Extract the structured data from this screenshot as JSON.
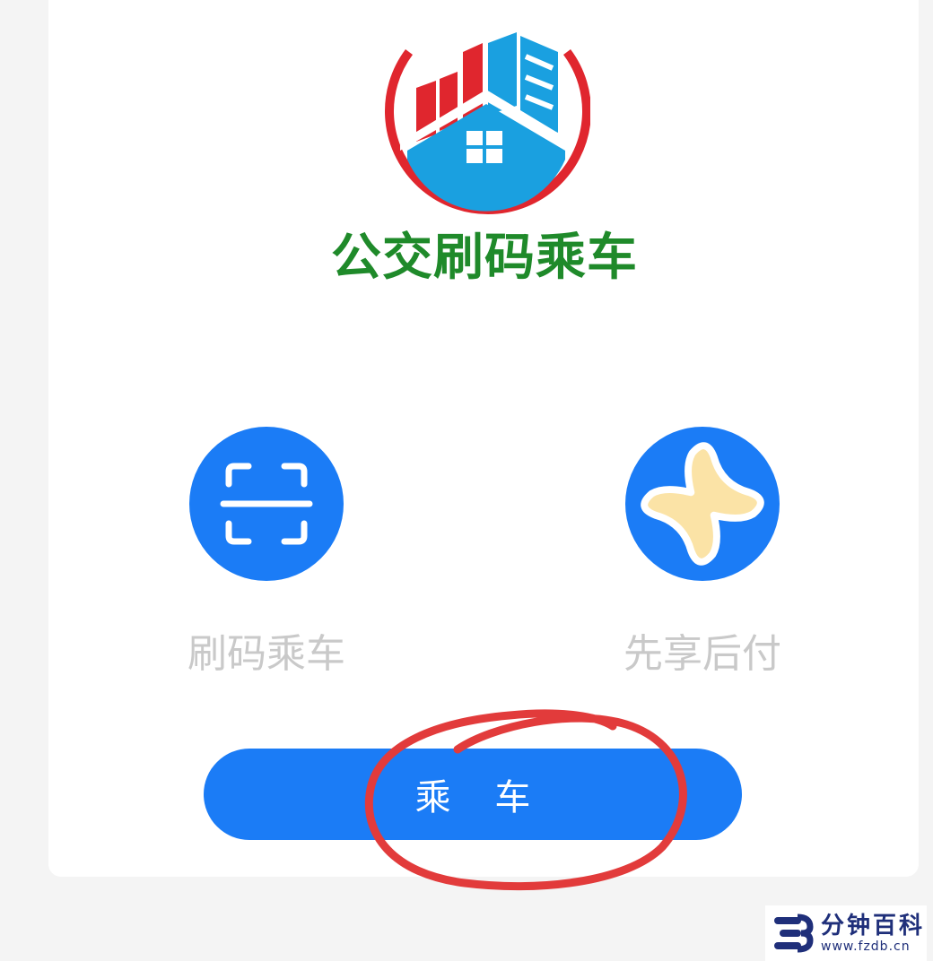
{
  "app": {
    "logo_text": "公交刷码乘车"
  },
  "features": [
    {
      "label": "刷码乘车",
      "icon": "scan-icon"
    },
    {
      "label": "先享后付",
      "icon": "pay-later-icon"
    }
  ],
  "ride_button": {
    "label": "乘 车"
  },
  "watermark": {
    "title": "分钟百科",
    "url": "www.fzdb.cn"
  },
  "colors": {
    "primary_blue": "#1b7cf6",
    "logo_green": "#1f8a2a",
    "logo_red": "#e0262e",
    "logo_blue": "#1aa0e0",
    "annotation_red": "#e23b3b",
    "pay_icon_yellow": "#fbe3a6"
  }
}
